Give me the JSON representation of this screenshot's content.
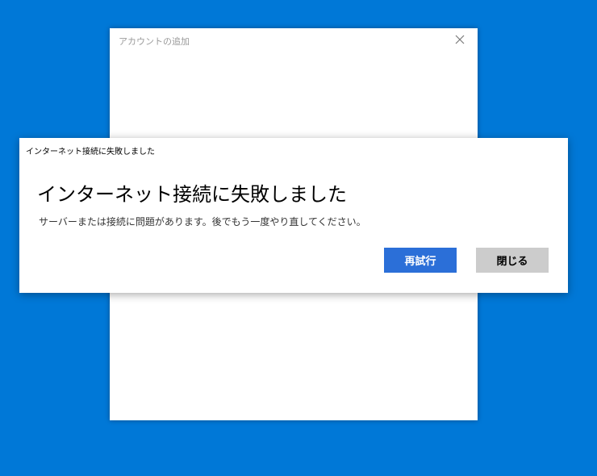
{
  "back_window": {
    "title": "アカウントの追加",
    "close_icon": "close-icon"
  },
  "dialog": {
    "title": "インターネット接続に失敗しました",
    "heading": "インターネット接続に失敗しました",
    "message": "サーバーまたは接続に問題があります。後でもう一度やり直してください。",
    "retry_label": "再試行",
    "close_label": "閉じる"
  },
  "colors": {
    "desktop": "#0078d7",
    "primary_button": "#2b6fd8",
    "secondary_button": "#cccccc"
  }
}
